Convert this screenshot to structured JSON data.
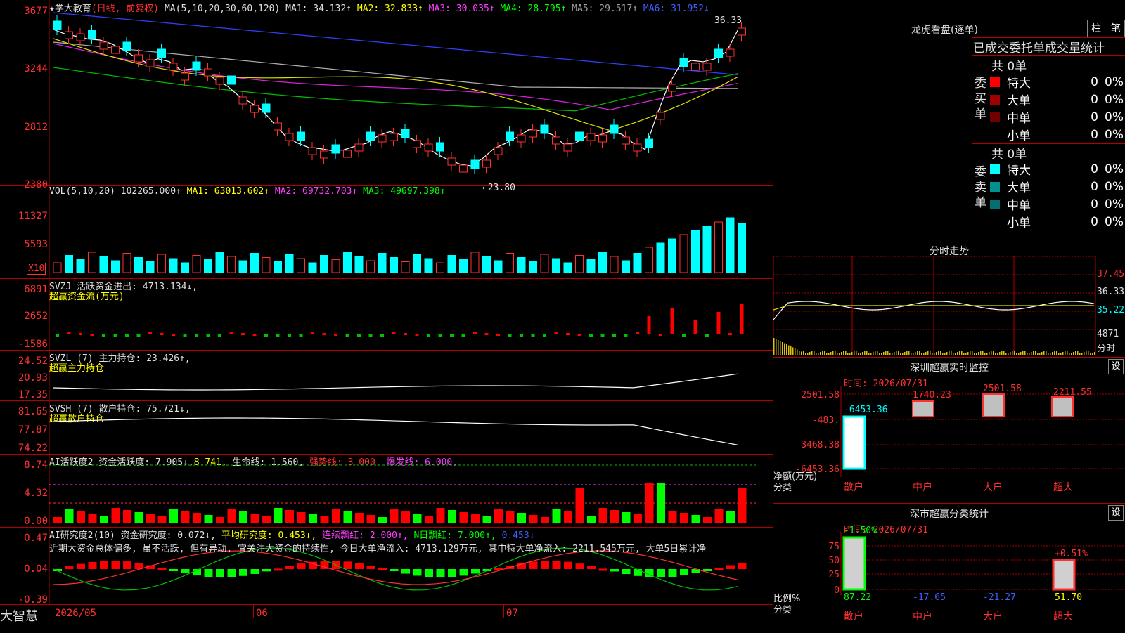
{
  "stock": {
    "name": "★学大教育",
    "mode": "(日线, 前复权)"
  },
  "ma_header": {
    "label": "MA(5,10,20,30,60,120)",
    "ma1": "MA1: 34.132↑",
    "ma2": "MA2: 32.833↑",
    "ma3": "MA3: 30.035↑",
    "ma4": "MA4: 28.795↑",
    "ma5": "MA5: 29.517↑",
    "ma6": "MA6: 31.952↓"
  },
  "price_axis": [
    "3677",
    "3244",
    "2812",
    "2380"
  ],
  "price_marks": {
    "high": "36.33",
    "low": "←23.80"
  },
  "vol_header": {
    "label": "VOL(5,10,20)",
    "value": "102265.000↑",
    "ma1": "MA1: 63013.602↑",
    "ma2": "MA2: 69732.703↑",
    "ma3": "MA3: 49697.398↑"
  },
  "vol_axis": [
    "11327",
    "5593",
    "X10"
  ],
  "svzj": {
    "label": "SVZJ  活跃资金进出: 4713.134↓,",
    "sub": "超赢资金流(万元)",
    "axis": [
      "6891",
      "2652",
      "-1586"
    ]
  },
  "svzl": {
    "label": "SVZL (7) 主力持仓: 23.426↑,",
    "sub": "超赢主力持仓",
    "axis": [
      "24.52",
      "20.93",
      "17.35"
    ]
  },
  "svsh": {
    "label": "SVSH (7) 散户持仓: 75.721↓,",
    "sub": "超赢散户持仓",
    "axis": [
      "81.65",
      "77.87",
      "74.22"
    ]
  },
  "ai1": {
    "label": "AI活跃度2 资金活跃度: 7.905↓,",
    "v2": "8.741,",
    "v3": "生命线: 1.560,",
    "v4": "强势线: 3.000,",
    "v5": "爆发线: 6.000,",
    "axis": [
      "8.74",
      "4.32",
      "0.00"
    ]
  },
  "ai2": {
    "label": "AI研究度2(10) 资金研究度: 0.072↓,",
    "v2": "平均研究度: 0.453↓,",
    "v3": "连续飘红: 2.000↑,",
    "v4": "N日飘红: 7.000↑,",
    "v5": "0.453↓",
    "axis": [
      "0.47",
      "0.04",
      "-0.39"
    ],
    "note": "近期大资金总体偏多, 虽不活跃, 但有异动, 宜关注大资金的持续性, 今日大单净流入: 4713.129万元, 其中特大单净流入: 2211.545万元, 大单5日累计净"
  },
  "date_axis": {
    "brand": "大智慧",
    "d1": "2026/05",
    "d2": "06",
    "d3": "07"
  },
  "lhb": {
    "title": "龙虎看盘(逐单)",
    "btn1": "柱",
    "btn2": "笔",
    "header": "已成交委托单成交量统计",
    "buy_label": "委买单",
    "sell_label": "委卖单",
    "buy_total": "共 0单",
    "sell_total": "共 0单",
    "rows": [
      {
        "name": "特大",
        "v": "0",
        "p": "0%"
      },
      {
        "name": "大单",
        "v": "0",
        "p": "0%"
      },
      {
        "name": "中单",
        "v": "0",
        "p": "0%"
      },
      {
        "name": "小单",
        "v": "0",
        "p": "0%"
      }
    ]
  },
  "fenshi": {
    "title": "分时走势",
    "axis": [
      "37.45",
      "36.33",
      "35.22",
      "4871",
      "分时"
    ]
  },
  "sz_monitor": {
    "title": "深圳超赢实时监控",
    "btn": "设",
    "time": "时间: 2026/07/31",
    "axis": [
      "2501.58",
      "-483.",
      "-3468.38",
      "-6453.36"
    ],
    "values": [
      "-6453.36",
      "1740.23",
      "2501.58",
      "2211.55"
    ],
    "ylabel": "净额(万元)",
    "xlabel": "分类",
    "cats": [
      "散户",
      "中户",
      "大户",
      "超大"
    ]
  },
  "sz_class": {
    "title": "深市超赢分类统计",
    "btn": "设",
    "time": "时间: 2026/07/31",
    "axis": [
      "75",
      "50",
      "25",
      "0"
    ],
    "top1": "-1.50%",
    "top4": "+0.51%",
    "bottom": [
      "87.22",
      "-17.65",
      "-21.27",
      "51.70"
    ],
    "ylabel": "比例%",
    "xlabel": "分类",
    "cats": [
      "散户",
      "中户",
      "大户",
      "超大"
    ]
  }
}
